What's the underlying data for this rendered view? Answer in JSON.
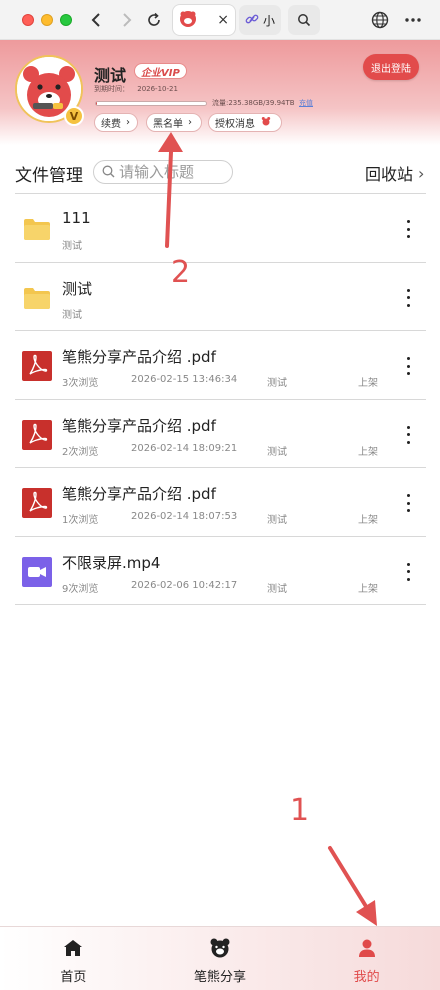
{
  "browser": {
    "active_tab_title": "",
    "inactive_tab_title": "小",
    "close_glyph": "×"
  },
  "profile": {
    "username": "测试",
    "vip_badge": "企业VIP",
    "expire_label": "到期时间：",
    "expire_date": "2026-10-21",
    "quota_text": "流量:235.38GB/39.94TB",
    "quota_link": "充值",
    "quota_used_fraction": 0.006,
    "renew_label": "续费",
    "blacklist_label": "黑名单",
    "auth_label": "授权消息",
    "logout_label": "退出登陆",
    "avatar_badge": "V"
  },
  "file_manager": {
    "title": "文件管理",
    "search_placeholder": "请输入标题",
    "recycle_label": "回收站",
    "files": [
      {
        "type": "folder",
        "name": "111",
        "views": "",
        "date": "",
        "owner": "测试",
        "status": ""
      },
      {
        "type": "folder",
        "name": "测试",
        "views": "",
        "date": "",
        "owner": "测试",
        "status": ""
      },
      {
        "type": "pdf",
        "name": "笔熊分享产品介绍 .pdf",
        "views": "3次浏览",
        "date": "2026-02-15 13:46:34",
        "owner": "测试",
        "status": "上架"
      },
      {
        "type": "pdf",
        "name": "笔熊分享产品介绍 .pdf",
        "views": "2次浏览",
        "date": "2026-02-14 18:09:21",
        "owner": "测试",
        "status": "上架"
      },
      {
        "type": "pdf",
        "name": "笔熊分享产品介绍 .pdf",
        "views": "1次浏览",
        "date": "2026-02-14 18:07:53",
        "owner": "测试",
        "status": "上架"
      },
      {
        "type": "video",
        "name": "不限录屏.mp4",
        "views": "9次浏览",
        "date": "2026-02-06 10:42:17",
        "owner": "测试",
        "status": "上架"
      }
    ]
  },
  "annotations": {
    "step1": "1",
    "step2": "2"
  },
  "tabbar": {
    "home": "首页",
    "share": "笔熊分享",
    "mine": "我的"
  },
  "colors": {
    "accent": "#e24b4b",
    "header_top": "#ee9a9c",
    "annotation": "#e05252",
    "video_icon": "#7b61e8",
    "pdf_icon": "#c8302c",
    "folder_icon": "#f3c64f"
  }
}
